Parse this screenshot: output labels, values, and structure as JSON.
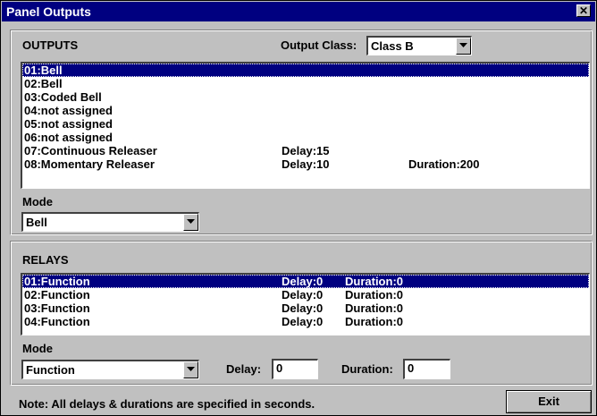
{
  "window": {
    "title": "Panel Outputs",
    "close_glyph": "✕"
  },
  "outputs": {
    "heading": "OUTPUTS",
    "output_class_label": "Output Class:",
    "output_class_value": "Class B",
    "items": [
      {
        "name": "01:Bell",
        "delay": "",
        "duration": ""
      },
      {
        "name": "02:Bell",
        "delay": "",
        "duration": ""
      },
      {
        "name": "03:Coded Bell",
        "delay": "",
        "duration": ""
      },
      {
        "name": "04:not assigned",
        "delay": "",
        "duration": ""
      },
      {
        "name": "05:not assigned",
        "delay": "",
        "duration": ""
      },
      {
        "name": "06:not assigned",
        "delay": "",
        "duration": ""
      },
      {
        "name": "07:Continuous Releaser",
        "delay": "Delay:15",
        "duration": ""
      },
      {
        "name": "08:Momentary Releaser",
        "delay": "Delay:10",
        "duration": "Duration:200"
      }
    ],
    "selected_index": 0,
    "mode_label": "Mode",
    "mode_value": "Bell"
  },
  "relays": {
    "heading": "RELAYS",
    "items": [
      {
        "name": "01:Function",
        "delay": "Delay:0",
        "duration": "Duration:0"
      },
      {
        "name": "02:Function",
        "delay": "Delay:0",
        "duration": "Duration:0"
      },
      {
        "name": "03:Function",
        "delay": "Delay:0",
        "duration": "Duration:0"
      },
      {
        "name": "04:Function",
        "delay": "Delay:0",
        "duration": "Duration:0"
      }
    ],
    "selected_index": 0,
    "mode_label": "Mode",
    "mode_value": "Function",
    "delay_label": "Delay:",
    "delay_value": "0",
    "duration_label": "Duration:",
    "duration_value": "0"
  },
  "footer": {
    "note": "Note:  All delays & durations are specified in seconds.",
    "exit_label": "Exit"
  },
  "colors": {
    "titlebar": "#000080",
    "selection": "#000080",
    "face": "#c0c0c0"
  }
}
